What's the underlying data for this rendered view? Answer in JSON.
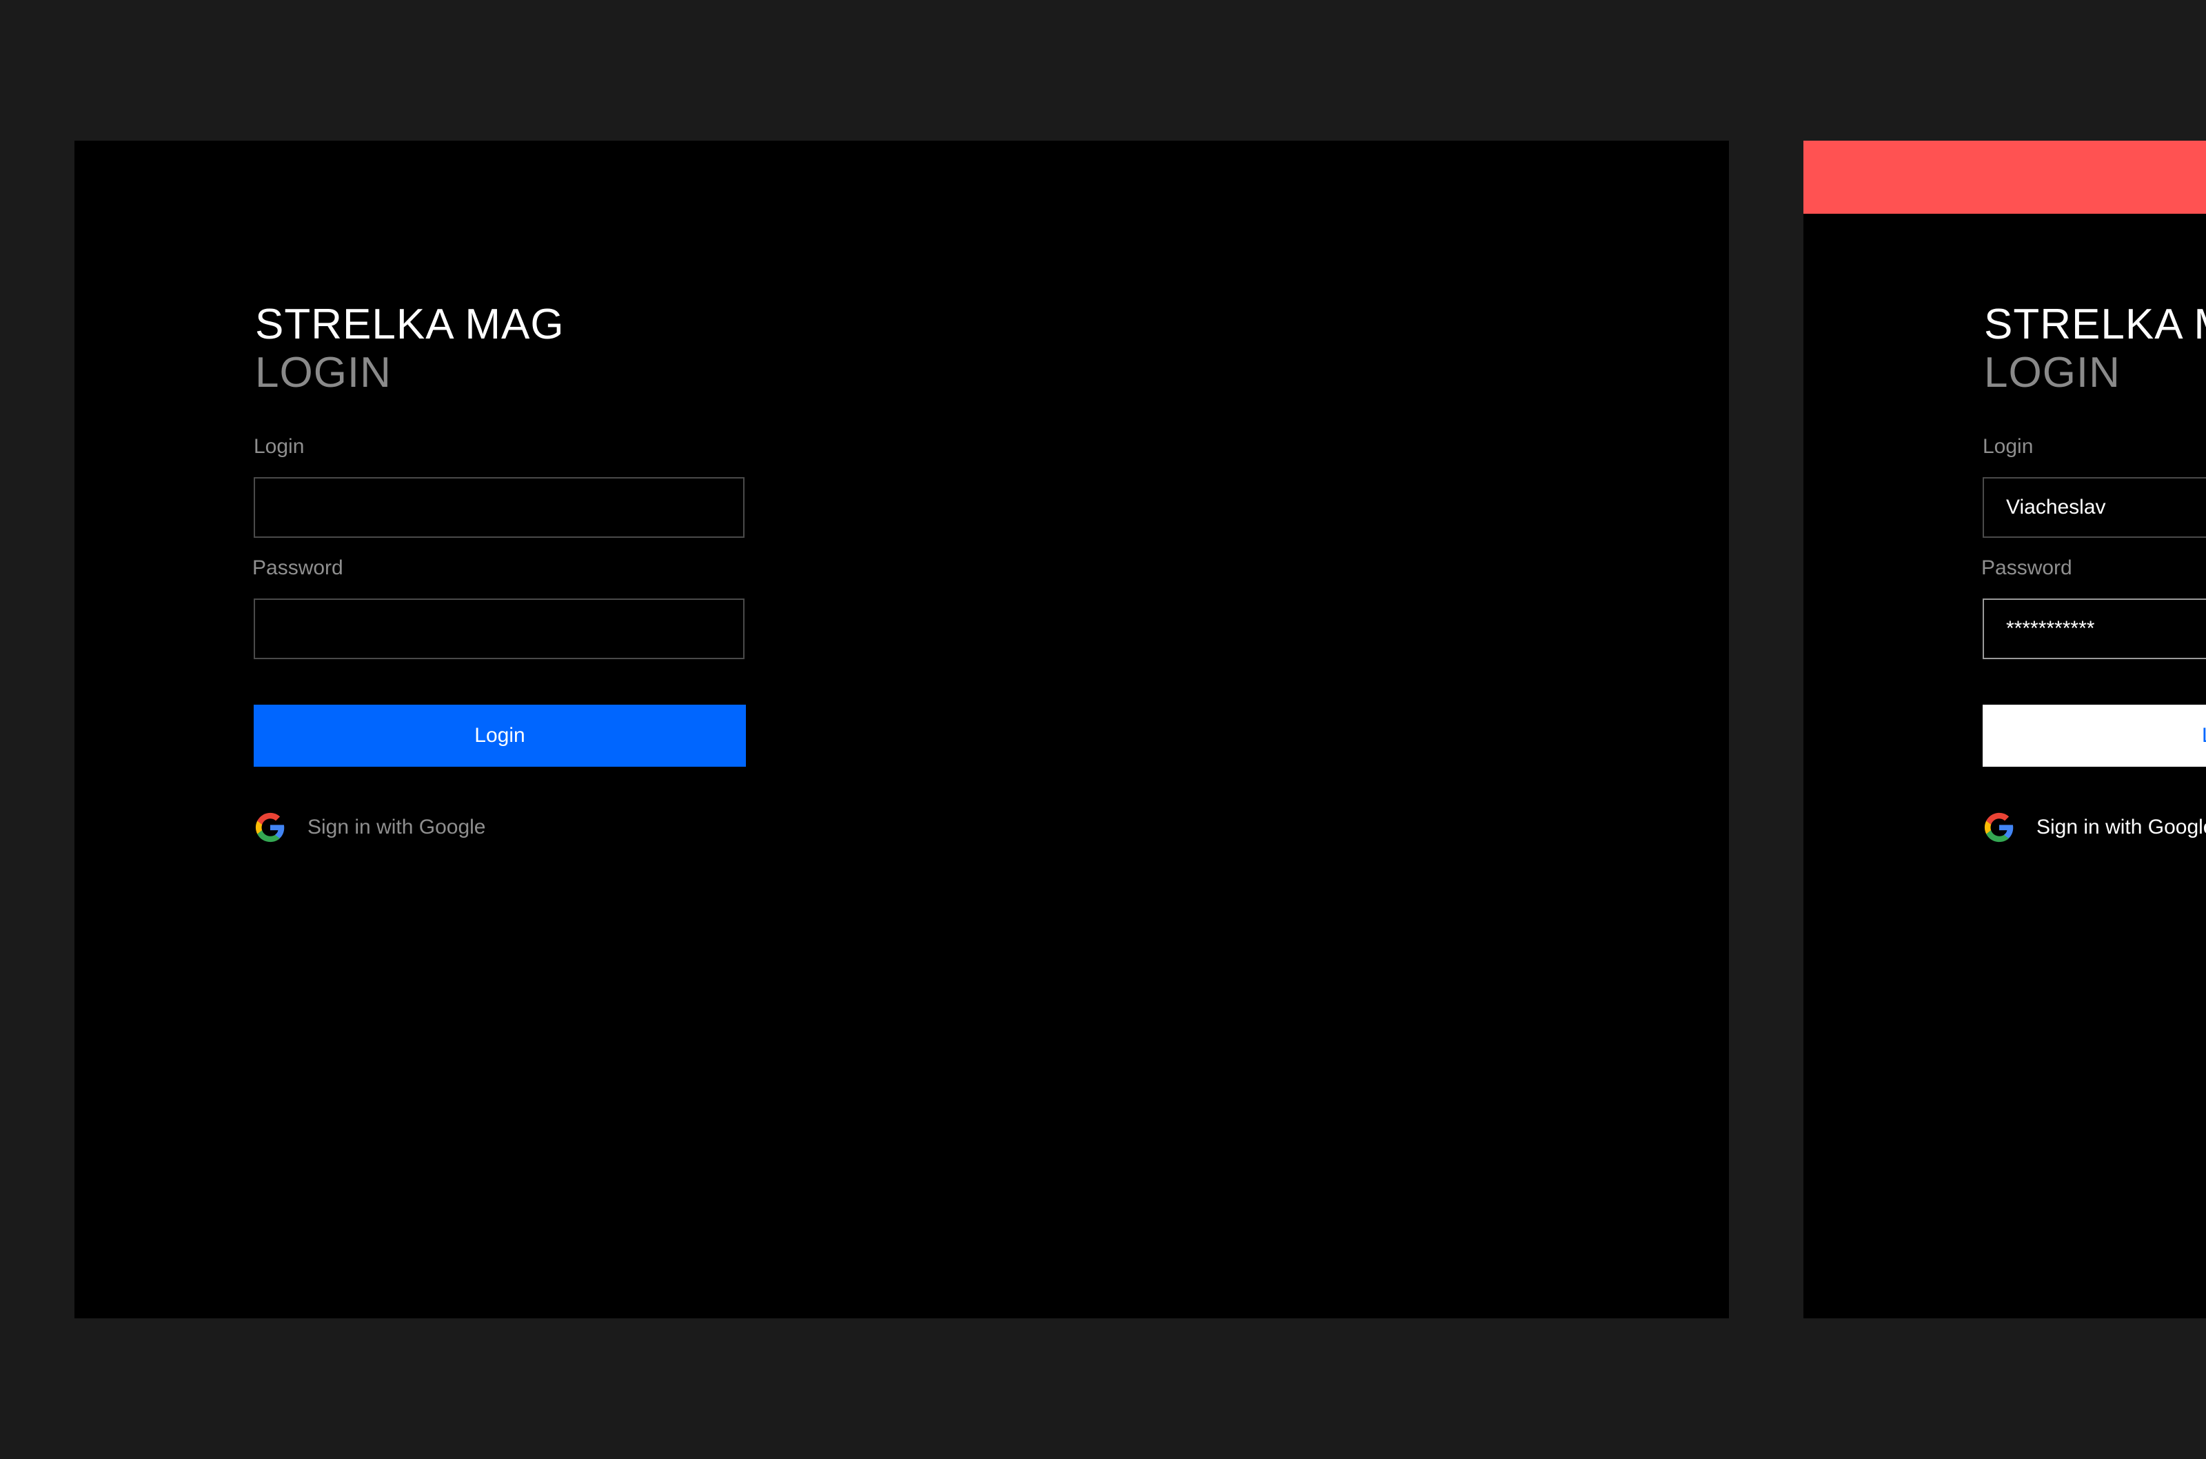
{
  "colors": {
    "background": "#1b1b1b",
    "panel": "#000000",
    "accent_blue": "#0066ff",
    "error_red": "#ff5252",
    "muted_text": "#8f8f8f"
  },
  "screens": [
    {
      "state": "empty",
      "brand": "STRELKA MAG",
      "subtitle": "LOGIN",
      "login_label": "Login",
      "login_value": "",
      "password_label": "Password",
      "password_value": "",
      "submit_label": "Login",
      "google_label": "Sign in with Google",
      "google_icon": "google-g-icon"
    },
    {
      "state": "error",
      "brand": "STRELKA MAG",
      "subtitle": "LOGIN",
      "login_label": "Login",
      "login_value": "Viacheslav",
      "password_label": "Password",
      "password_value": "***********",
      "submit_label": "Login",
      "google_label": "Sign in with Google",
      "google_icon": "google-g-icon"
    }
  ]
}
